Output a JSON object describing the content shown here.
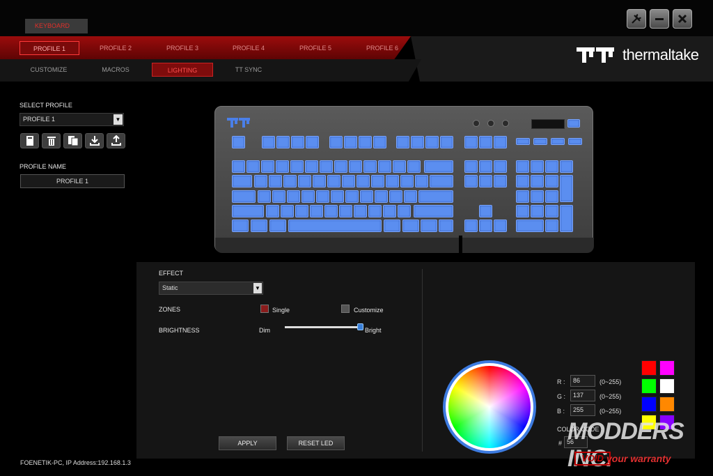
{
  "device_tab": "KEYBOARD",
  "profiles": [
    "PROFILE 1",
    "PROFILE 2",
    "PROFILE 3",
    "PROFILE 4",
    "PROFILE 5",
    "PROFILE 6"
  ],
  "active_profile_index": 0,
  "subnav": [
    "CUSTOMIZE",
    "MACROS",
    "LIGHTING",
    "TT SYNC"
  ],
  "active_subnav_index": 2,
  "brand": {
    "name": "thermaltake",
    "logo_mark": "TT"
  },
  "window_controls": {
    "settings_icon": "tools-icon",
    "minimize_icon": "minimize-icon",
    "close_icon": "close-icon"
  },
  "left_panel": {
    "select_profile_label": "SELECT PROFILE",
    "selected_profile": "PROFILE 1",
    "profile_name_label": "PROFILE NAME",
    "profile_name_value": "PROFILE 1",
    "profile_actions": [
      "new-profile-icon",
      "delete-icon",
      "copy-icon",
      "import-icon",
      "export-icon"
    ]
  },
  "lighting": {
    "effect_label": "EFFECT",
    "effect_value": "Static",
    "zones_label": "ZONES",
    "zone_single": "Single",
    "zone_customize": "Customize",
    "zone_single_color": "#8a1c1c",
    "zone_customize_color": "#555555",
    "brightness_label": "BRIGHTNESS",
    "brightness_min": "Dim",
    "brightness_max": "Bright",
    "brightness_level": 1.0,
    "apply_label": "APPLY",
    "reset_label": "RESET LED"
  },
  "color": {
    "r_label": "R :",
    "g_label": "G :",
    "b_label": "B :",
    "r": "86",
    "g": "137",
    "b": "255",
    "range": "(0~255)",
    "code_label": "COLOR CODE :",
    "hash": "#",
    "code": "56",
    "swatches": [
      "#ff0000",
      "#ff00ff",
      "#00ff00",
      "#ffffff",
      "#0000ff",
      "#ff8800",
      "#ffff00",
      "#8800ff"
    ]
  },
  "status": "FOENETIK-PC, IP Address:192.168.1.3",
  "watermark": {
    "main": "MODDERS INC.",
    "void": "VOID",
    "tagline": "your warranty"
  },
  "key_color": "#5b8ef0"
}
